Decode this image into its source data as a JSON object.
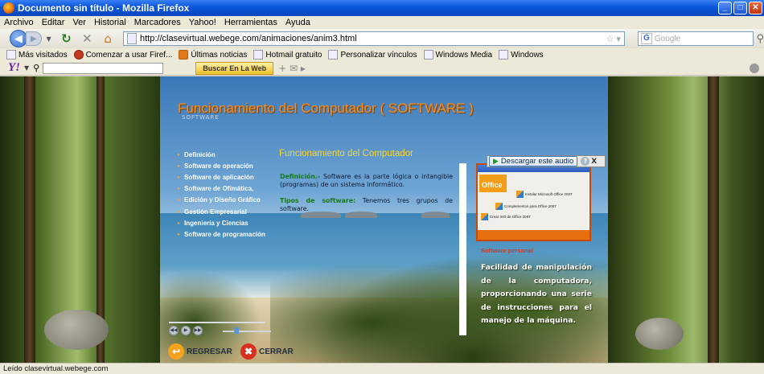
{
  "window": {
    "title": "Documento sin título - Mozilla Firefox"
  },
  "menubar": [
    "Archivo",
    "Editar",
    "Ver",
    "Historial",
    "Marcadores",
    "Yahoo!",
    "Herramientas",
    "Ayuda"
  ],
  "navbar": {
    "url": "http://clasevirtual.webege.com/animaciones/anim3.html",
    "search_placeholder": "Google"
  },
  "bookmarks": [
    "Más visitados",
    "Comenzar a usar Firef...",
    "Últimas noticias",
    "Hotmail gratuito",
    "Personalizar vínculos",
    "Windows Media",
    "Windows"
  ],
  "yahoo_toolbar": {
    "logo": "Y!",
    "search_button": "Buscar En La Web"
  },
  "audio": {
    "label": "Descargar este audio",
    "help": "?",
    "close": "X"
  },
  "page": {
    "title": "Funcionamiento del Computador  ( SOFTWARE )",
    "subtitle": "SOFTWARE",
    "menu": [
      "Definición",
      "Software de operación",
      "Software de aplicación",
      "Software de Ofimática,",
      "Edición y Diseño Gráfico",
      "Gestión Empresarial",
      "Ingeniería y Ciencias",
      "Software de programación"
    ],
    "content_title": "Funcionamiento del Computador",
    "definition_label": "Definición.-",
    "definition_text": " Software es la parte lógica o intangible (programas) de un sistema informático.",
    "types_label": "Tipos de software:",
    "types_text": " Tenemos tres grupos de software.",
    "office_brand": "Office",
    "office_options": [
      "Instalar Microsoft Office 2007",
      "Complementos para Office 2007",
      "Crear ISO de Office 2007"
    ],
    "side_title": "Software personal",
    "side_text": "Facilidad de manipulación de la computadora, proporcionando una serie de instrucciones para el manejo de la máquina.",
    "btn_back": "REGRESAR",
    "btn_close": "CERRAR"
  },
  "status": "Leído clasevirtual.webege.com"
}
